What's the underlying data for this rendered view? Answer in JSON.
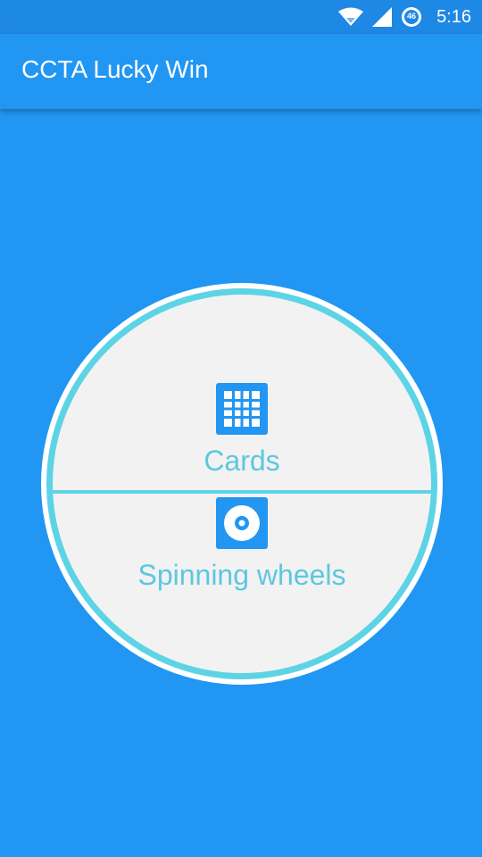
{
  "status_bar": {
    "network_badge": "46",
    "time": "5:16"
  },
  "app_bar": {
    "title": "CCTA Lucky Win"
  },
  "menu": {
    "options": [
      {
        "label": "Cards",
        "icon": "grid-icon"
      },
      {
        "label": "Spinning wheels",
        "icon": "disc-icon"
      }
    ]
  },
  "colors": {
    "primary": "#2196f3",
    "status_bar": "#1e88e5",
    "accent": "#5dd3e6",
    "face": "#f2f2f2",
    "icon_bg": "#2196f3"
  }
}
